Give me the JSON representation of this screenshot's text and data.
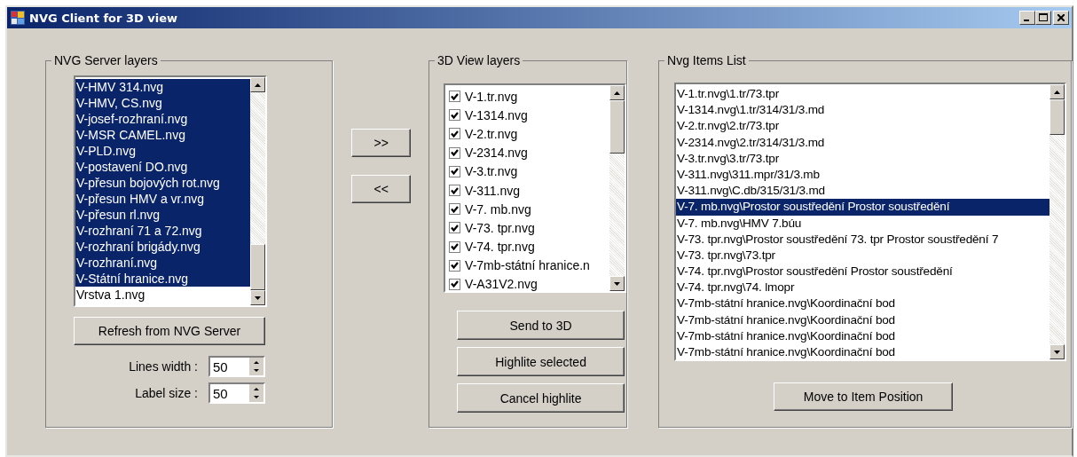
{
  "window": {
    "title": "NVG Client for 3D view"
  },
  "server_layers": {
    "title": "NVG Server layers",
    "items": [
      {
        "label": "V-HMV 314.nvg",
        "selected": true
      },
      {
        "label": "V-HMV, CS.nvg",
        "selected": true
      },
      {
        "label": "V-josef-rozhraní.nvg",
        "selected": true
      },
      {
        "label": "V-MSR CAMEL.nvg",
        "selected": true
      },
      {
        "label": "V-PLD.nvg",
        "selected": true
      },
      {
        "label": "V-postavení DO.nvg",
        "selected": true
      },
      {
        "label": "V-přesun bojových rot.nvg",
        "selected": true
      },
      {
        "label": "V-přesun HMV a vr.nvg",
        "selected": true
      },
      {
        "label": "V-přesun rl.nvg",
        "selected": true
      },
      {
        "label": "V-rozhraní 71 a 72.nvg",
        "selected": true
      },
      {
        "label": "V-rozhraní brigády.nvg",
        "selected": true
      },
      {
        "label": "V-rozhraní.nvg",
        "selected": true
      },
      {
        "label": "V-Státní hranice.nvg",
        "selected": true
      },
      {
        "label": "Vrstva 1.nvg",
        "selected": false
      }
    ],
    "refresh_button": "Refresh from NVG Server",
    "lines_width": {
      "label": "Lines width :",
      "value": "50"
    },
    "label_size": {
      "label": "Label size :",
      "value": "50"
    }
  },
  "move_buttons": [
    ">>",
    "<<"
  ],
  "view_layers": {
    "title": "3D View layers",
    "items": [
      {
        "label": "V-1.tr.nvg",
        "checked": true
      },
      {
        "label": "V-1314.nvg",
        "checked": true
      },
      {
        "label": "V-2.tr.nvg",
        "checked": true
      },
      {
        "label": "V-2314.nvg",
        "checked": true
      },
      {
        "label": "V-3.tr.nvg",
        "checked": true
      },
      {
        "label": "V-311.nvg",
        "checked": true
      },
      {
        "label": "V-7. mb.nvg",
        "checked": true
      },
      {
        "label": "V-73. tpr.nvg",
        "checked": true
      },
      {
        "label": "V-74. tpr.nvg",
        "checked": true
      },
      {
        "label": "V-7mb-státní hranice.n",
        "checked": true
      },
      {
        "label": "V-A31V2.nvg",
        "checked": true
      }
    ],
    "buttons": [
      "Send to 3D",
      "Highlite selected",
      "Cancel highlite"
    ]
  },
  "items_list": {
    "title": "Nvg Items List",
    "items": [
      {
        "label": "V-1.tr.nvg\\1.tr/73.tpr",
        "selected": false
      },
      {
        "label": "V-1314.nvg\\1.tr/314/31/3.md",
        "selected": false
      },
      {
        "label": "V-2.tr.nvg\\2.tr/73.tpr",
        "selected": false
      },
      {
        "label": "V-2314.nvg\\2.tr/314/31/3.md",
        "selected": false
      },
      {
        "label": "V-3.tr.nvg\\3.tr/73.tpr",
        "selected": false
      },
      {
        "label": "V-311.nvg\\311.mpr/31/3.mb",
        "selected": false
      },
      {
        "label": "V-311.nvg\\C.db/315/31/3.md",
        "selected": false
      },
      {
        "label": "V-7. mb.nvg\\Prostor soustředění Prostor soustředění",
        "selected": true
      },
      {
        "label": "V-7. mb.nvg\\HMV 7.búu",
        "selected": false
      },
      {
        "label": "V-73. tpr.nvg\\Prostor soustředění 73. tpr Prostor soustředění 7",
        "selected": false
      },
      {
        "label": "V-73. tpr.nvg\\73.tpr",
        "selected": false
      },
      {
        "label": "V-74. tpr.nvg\\Prostor soustředění Prostor soustředění",
        "selected": false
      },
      {
        "label": "V-74. tpr.nvg\\74. lmopr",
        "selected": false
      },
      {
        "label": "V-7mb-státní hranice.nvg\\Koordinační bod",
        "selected": false
      },
      {
        "label": "V-7mb-státní hranice.nvg\\Koordinační bod",
        "selected": false
      },
      {
        "label": "V-7mb-státní hranice.nvg\\Koordinační bod",
        "selected": false
      },
      {
        "label": "V-7mb-státní hranice.nvg\\Koordinační bod",
        "selected": false
      }
    ],
    "button": "Move to Item Position"
  }
}
